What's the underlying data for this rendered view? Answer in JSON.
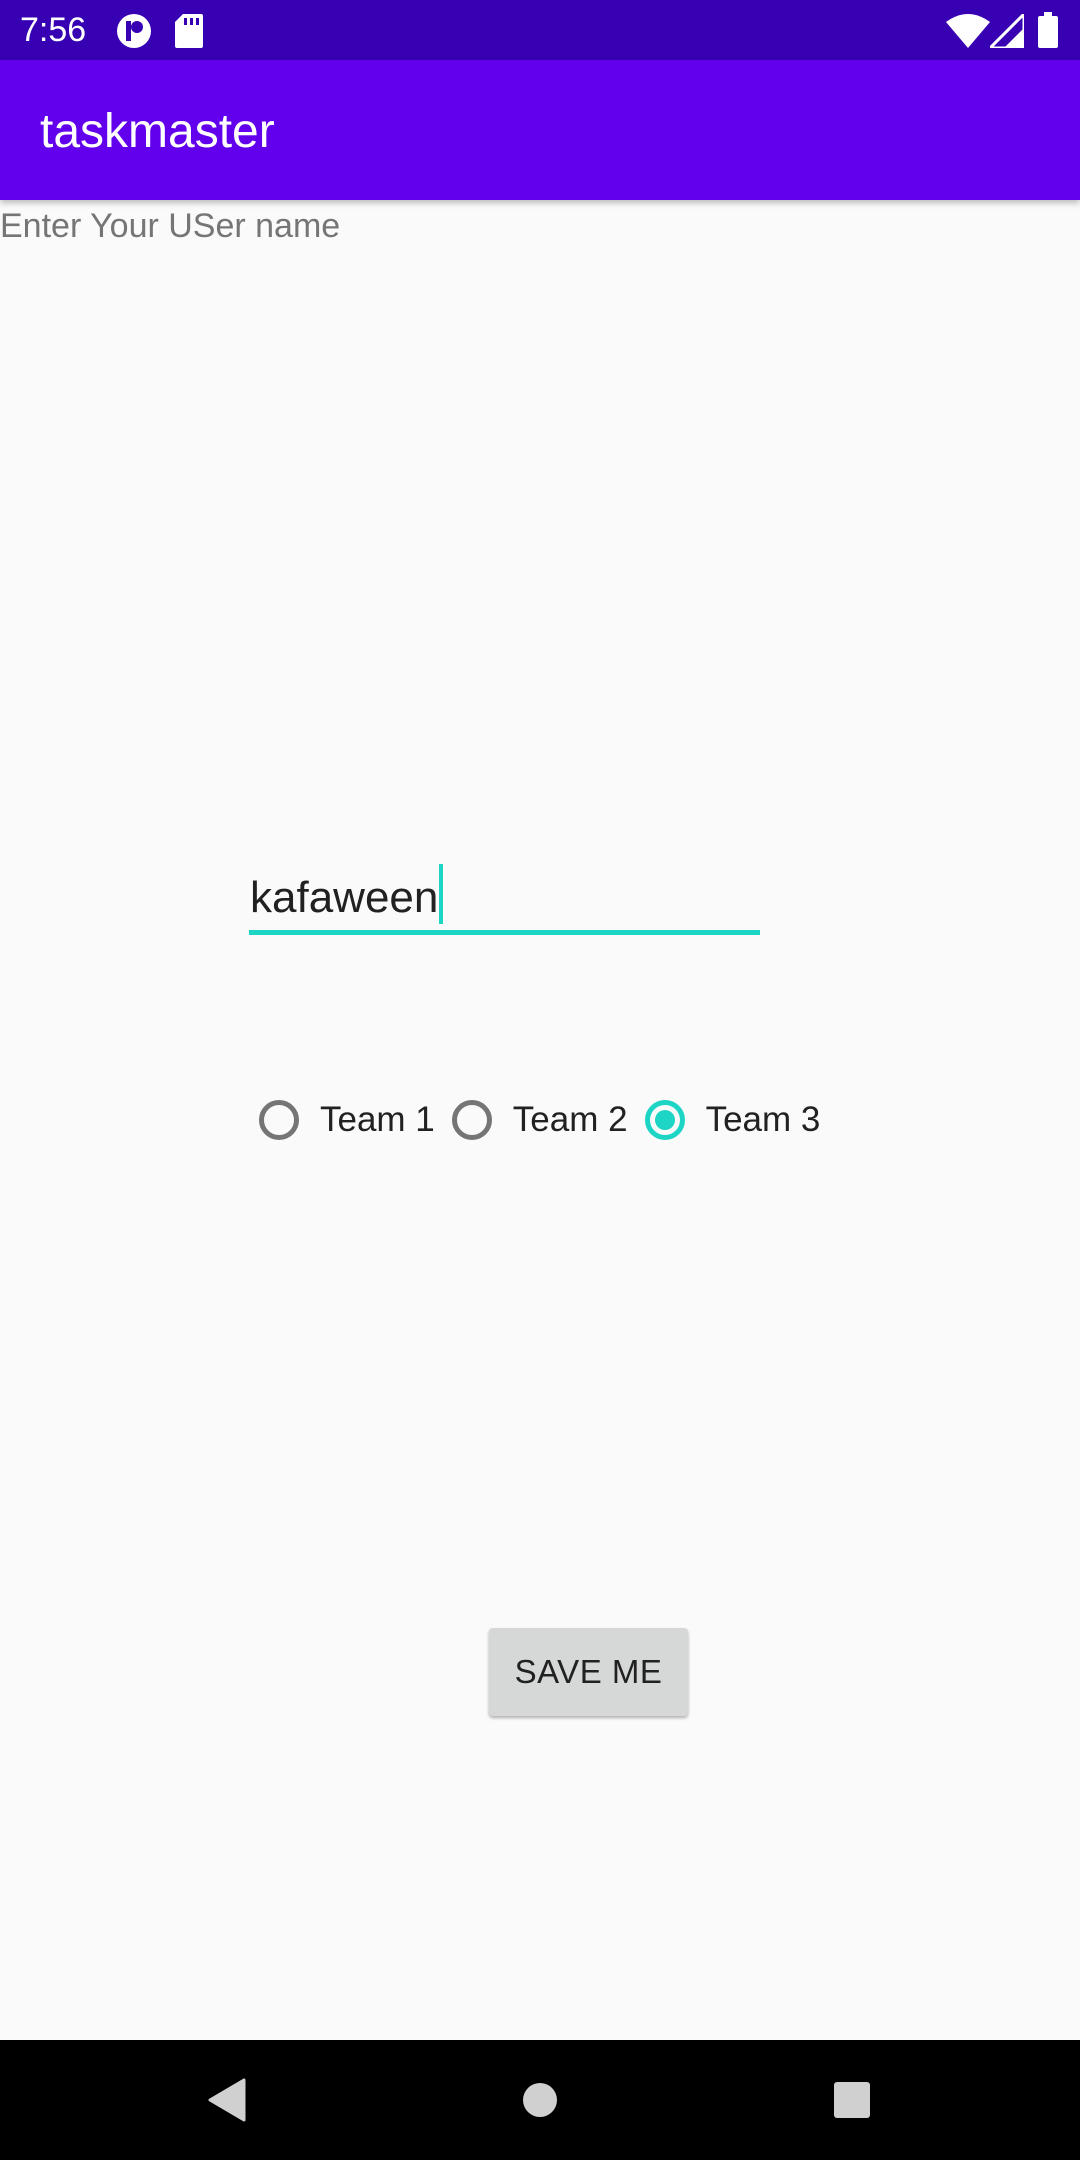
{
  "status_bar": {
    "time": "7:56",
    "left_icons": [
      "notification-p-icon",
      "sd-card-icon"
    ],
    "right_icons": [
      "wifi-icon",
      "signal-icon",
      "battery-icon"
    ],
    "background_color": "#3700b3"
  },
  "app_bar": {
    "title": "taskmaster",
    "background_color": "#6200ee"
  },
  "main": {
    "prompt_label": "Enter Your USer name",
    "username_value": "kafaween",
    "accent_color": "#1dd5c5",
    "radio_options": [
      {
        "label": "Team 1",
        "checked": false
      },
      {
        "label": "Team 2",
        "checked": false
      },
      {
        "label": "Team 3",
        "checked": true
      }
    ],
    "save_label": "SAVE ME"
  },
  "nav_bar": {
    "buttons": [
      "back-icon",
      "home-icon",
      "recents-icon"
    ]
  }
}
